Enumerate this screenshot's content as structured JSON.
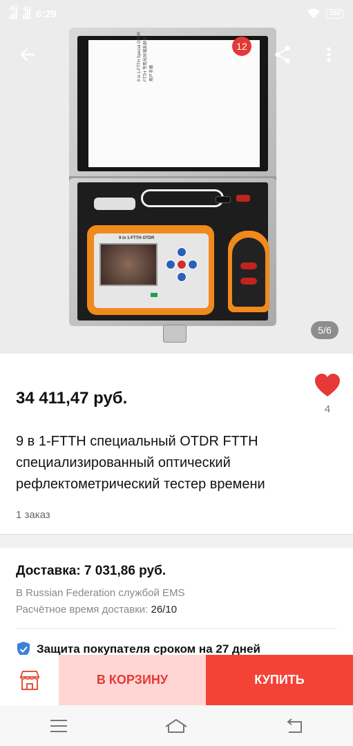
{
  "status_bar": {
    "time": "6:29",
    "network1": "4G",
    "network2": "4G",
    "battery": "100"
  },
  "gallery": {
    "counter": "5/6",
    "cart_badge": "12"
  },
  "product": {
    "price": "34 411,47 руб.",
    "favorites_count": "4",
    "title": "9 в 1-FTTH специальный OTDR FTTH специализированный оптический рефлектометрический тестер времени",
    "orders": "1 заказ"
  },
  "shipping": {
    "title": "Доставка: 7 031,86 руб.",
    "method": "В Russian Federation службой EMS",
    "eta_label": "Расчётное время доставки:",
    "eta_value": "26/10"
  },
  "protection": {
    "text": "Защита покупателя сроком на 27 дней"
  },
  "actions": {
    "add_to_cart": "В КОРЗИНУ",
    "buy": "КУПИТЬ"
  },
  "colors": {
    "accent": "#f44336",
    "accent_light": "#ffd6d3",
    "favorite": "#e53935",
    "store_icon": "#e5533d"
  }
}
